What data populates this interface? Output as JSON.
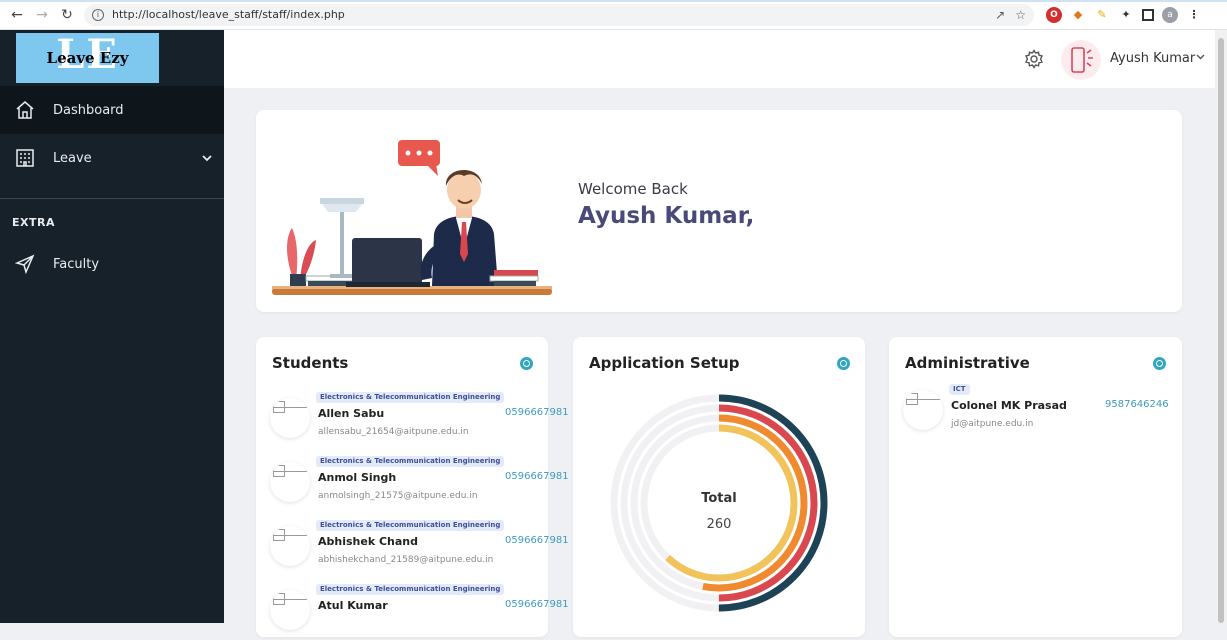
{
  "browser": {
    "url": "http://localhost/leave_staff/staff/index.php"
  },
  "logo": {
    "big": "LE",
    "text": "Leave Ezy"
  },
  "sidebar": {
    "items": [
      {
        "label": "Dashboard",
        "icon": "home-icon"
      },
      {
        "label": "Leave",
        "icon": "building-icon"
      }
    ],
    "section": "EXTRA",
    "extra_items": [
      {
        "label": "Faculty",
        "icon": "send-icon"
      }
    ]
  },
  "header": {
    "user_name": "Ayush Kumar"
  },
  "welcome": {
    "greeting": "Welcome Back",
    "name": "Ayush Kumar,"
  },
  "students": {
    "title": "Students",
    "list": [
      {
        "department": "Electronics & Telecommunication Engineering",
        "name": "Allen Sabu",
        "email": "allensabu_21654@aitpune.edu.in",
        "phone": "0596667981"
      },
      {
        "department": "Electronics & Telecommunication Engineering",
        "name": "Anmol Singh",
        "email": "anmolsingh_21575@aitpune.edu.in",
        "phone": "0596667981"
      },
      {
        "department": "Electronics & Telecommunication Engineering",
        "name": "Abhishek Chand",
        "email": "abhishekchand_21589@aitpune.edu.in",
        "phone": "0596667981"
      },
      {
        "department": "Electronics & Telecommunication Engineering",
        "name": "Atul Kumar",
        "email": "",
        "phone": "0596667981"
      }
    ]
  },
  "application_setup": {
    "title": "Application Setup",
    "total_label": "Total",
    "total_value": "260",
    "ring_colors": [
      "#1e4356",
      "#d9474f",
      "#f08a2e",
      "#f2c35a"
    ],
    "ring_fractions": [
      0.5,
      0.5,
      0.53,
      0.62
    ]
  },
  "administrative": {
    "title": "Administrative",
    "list": [
      {
        "department": "ICT",
        "name": "Colonel MK Prasad",
        "email": "jd@aitpune.edu.in",
        "phone": "9587646246"
      }
    ]
  },
  "colors": {
    "sidebar_bg": "#17212a",
    "accent": "#2fa7c1",
    "heading": "#4a4a7a"
  }
}
